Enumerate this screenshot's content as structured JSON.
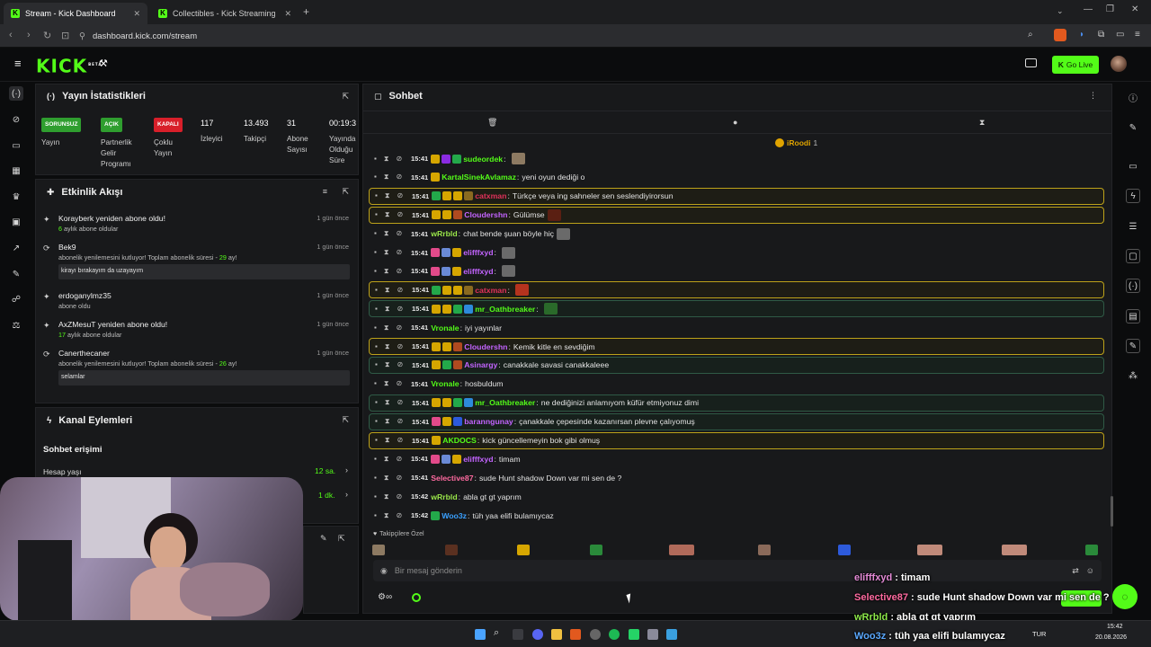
{
  "browser": {
    "tabs": [
      {
        "title": "Stream - Kick Dashboard",
        "active": true
      },
      {
        "title": "Collectibles - Kick Streaming",
        "active": false
      }
    ],
    "url": "dashboard.kick.com/stream"
  },
  "header": {
    "logo": "KICK",
    "logo_tag": "BETA",
    "go_live": "Go Live"
  },
  "stats_panel": {
    "title": "Yayın İstatistikleri",
    "items": [
      {
        "badge": "SORUNSUZ",
        "badge_color": "#2f9e2f",
        "label": "Yayın"
      },
      {
        "badge": "AÇIK",
        "badge_color": "#2f9e2f",
        "label": "Partnerlik Gelir Programı"
      },
      {
        "badge": "KAPALI",
        "badge_color": "#d81f2a",
        "label": "Çoklu Yayın"
      },
      {
        "value": "117",
        "label": "İzleyici"
      },
      {
        "value": "13.493",
        "label": "Takipçi"
      },
      {
        "value": "31",
        "label": "Abone Sayısı"
      },
      {
        "value": "00:19:3",
        "label": "Yayında Olduğu Süre"
      }
    ]
  },
  "activity_panel": {
    "title": "Etkinlik Akışı",
    "events": [
      {
        "name": "Korayberk yeniden abone oldu!",
        "sub_num": "6",
        "sub": " aylık abone oldular",
        "time": "1 gün önce",
        "msg": ""
      },
      {
        "name": "Bek9",
        "sub": "abonelik yenilemesini kutluyor! Toplam abonelik süresi - ",
        "sub_num2": "29",
        "sub_end": " ay!",
        "time": "1 gün önce",
        "msg": "kirayı bırakayım da uzayayım"
      },
      {
        "name": "erdoganylmz35",
        "sub": "abone oldu",
        "time": "1 gün önce",
        "msg": ""
      },
      {
        "name": "AxZMesuT yeniden abone oldu!",
        "sub_num": "17",
        "sub": " aylık abone oldular",
        "time": "1 gün önce",
        "msg": ""
      },
      {
        "name": "Canerthecaner",
        "sub": "abonelik yenilemesini kutluyor! Toplam abonelik süresi - ",
        "sub_num2": "26",
        "sub_end": " ay!",
        "time": "1 gün önce",
        "msg": "selamlar"
      }
    ]
  },
  "channel_panel": {
    "title": "Kanal Eylemleri",
    "section": "Sohbet erişimi",
    "rows": [
      {
        "label": "Hesap yaşı",
        "value": "12 sa."
      },
      {
        "label": "",
        "value": "1 dk."
      }
    ]
  },
  "chat": {
    "title": "Sohbet",
    "pinned_user": "iRoodi",
    "pinned_count": "1",
    "messages": [
      {
        "time": "15:41",
        "user": "sudeordek",
        "color": "#53fc18",
        "text": "",
        "hl": "",
        "badges": [
          "#d6a600",
          "#8a2be2",
          "#23a94a"
        ],
        "emote": "#8d7a62"
      },
      {
        "time": "15:41",
        "user": "KartalSinekAvlamaz",
        "color": "#53fc18",
        "text": "yeni oyun dediği o",
        "hl": "",
        "badges": [
          "#d6a600"
        ],
        "emote": ""
      },
      {
        "time": "15:41",
        "user": "catxman",
        "color": "#e0315a",
        "text": "Türkçe veya ing sahneler sen seslendiyirorsun",
        "hl": "gold",
        "badges": [
          "#23a94a",
          "#d6a600",
          "#d6a600",
          "#8a6a20"
        ],
        "emote": ""
      },
      {
        "time": "15:41",
        "user": "Cloudershn",
        "color": "#c364ff",
        "text": "Gülümse",
        "hl": "gold",
        "badges": [
          "#d6a600",
          "#d6a600",
          "#b04a20"
        ],
        "emote": "#5a1f12"
      },
      {
        "time": "15:41",
        "user": "wRrbld",
        "color": "#9be84a",
        "text": "chat bende şuan böyle hiç",
        "hl": "",
        "badges": [],
        "emote": "#6a6a6a"
      },
      {
        "time": "15:41",
        "user": "elifffxyd",
        "color": "#c364ff",
        "text": "",
        "hl": "",
        "badges": [
          "#e24a8a",
          "#6a8ad6",
          "#d6a600"
        ],
        "emote": "#6a6a6a"
      },
      {
        "time": "15:41",
        "user": "elifffxyd",
        "color": "#c364ff",
        "text": "",
        "hl": "",
        "badges": [
          "#e24a8a",
          "#6a8ad6",
          "#d6a600"
        ],
        "emote": "#6a6a6a"
      },
      {
        "time": "15:41",
        "user": "catxman",
        "color": "#e0315a",
        "text": "",
        "hl": "gold",
        "badges": [
          "#23a94a",
          "#d6a600",
          "#d6a600",
          "#8a6a20"
        ],
        "emote": "#b5331e"
      },
      {
        "time": "15:41",
        "user": "mr_Oathbreaker",
        "color": "#53fc18",
        "text": "",
        "hl": "green",
        "badges": [
          "#d6a600",
          "#d6a600",
          "#23a94a",
          "#2d8adb"
        ],
        "emote": "#2a6a2a"
      },
      {
        "time": "15:41",
        "user": "Vronale",
        "color": "#53fc18",
        "text": "iyi yayınlar",
        "hl": "",
        "badges": [],
        "emote": ""
      },
      {
        "time": "15:41",
        "user": "Cloudershn",
        "color": "#c364ff",
        "text": "Kemik kitle en sevdiğim",
        "hl": "gold",
        "badges": [
          "#d6a600",
          "#d6a600",
          "#b04a20"
        ],
        "emote": ""
      },
      {
        "time": "15:41",
        "user": "Asinargy",
        "color": "#c364ff",
        "text": "canakkale savasi canakkaleee",
        "hl": "green",
        "badges": [
          "#d6a600",
          "#23a94a",
          "#b04a20"
        ],
        "emote": ""
      },
      {
        "time": "15:41",
        "user": "Vronale",
        "color": "#53fc18",
        "text": "hosbuldum",
        "hl": "",
        "badges": [],
        "emote": ""
      },
      {
        "time": "15:41",
        "user": "mr_Oathbreaker",
        "color": "#53fc18",
        "text": "ne dediğinizi anlamıyom küfür etmiyonuz dimi",
        "hl": "green",
        "badges": [
          "#d6a600",
          "#d6a600",
          "#23a94a",
          "#2d8adb"
        ],
        "emote": ""
      },
      {
        "time": "15:41",
        "user": "baranngunay",
        "color": "#c364ff",
        "text": "çanakkale çepesinde kazanırsan plevne çalıyomuş",
        "hl": "green",
        "badges": [
          "#e24a8a",
          "#d6a600",
          "#2d5adb"
        ],
        "emote": ""
      },
      {
        "time": "15:41",
        "user": "AKDOCS",
        "color": "#53fc18",
        "text": "kick güncellemeyin bok gibi olmuş",
        "hl": "gold",
        "badges": [
          "#d6a600"
        ],
        "emote": ""
      },
      {
        "time": "15:41",
        "user": "elifffxyd",
        "color": "#c364ff",
        "text": "timam",
        "hl": "",
        "badges": [
          "#e24a8a",
          "#6a8ad6",
          "#d6a600"
        ],
        "emote": ""
      },
      {
        "time": "15:41",
        "user": "Selective87",
        "color": "#ff6aa0",
        "text": "sude Hunt shadow Down var mi sen de ?",
        "hl": "",
        "badges": [],
        "emote": ""
      },
      {
        "time": "15:42",
        "user": "wRrbld",
        "color": "#9be84a",
        "text": "abla gt gt yaprım",
        "hl": "",
        "badges": [],
        "emote": ""
      },
      {
        "time": "15:42",
        "user": "Woo3z",
        "color": "#3aa0ff",
        "text": "tüh yaa elifi bulamıycaz",
        "hl": "",
        "badges": [
          "#23a94a"
        ],
        "emote": ""
      }
    ],
    "emote_bar_label": "Takipçilere Özel",
    "input_placeholder": "Bir mesaj gönderin"
  },
  "overlay_chat": [
    {
      "user": "elifffxyd",
      "color": "#e48ad6",
      "text": " : timam"
    },
    {
      "user": "Selective87",
      "color": "#ff6aa0",
      "text": " : sude Hunt shadow Down var mi sen de ?"
    },
    {
      "user": "wRrbld",
      "color": "#8de84a",
      "text": " : abla gt gt yaprım"
    },
    {
      "user": "Woo3z",
      "color": "#5aa8ff",
      "text": " : tüh yaa elifi bulamıycaz"
    }
  ],
  "taskbar": {
    "lang": "TUR",
    "time": "15:42",
    "date": "20.08.2026"
  },
  "colors": {
    "accent": "#53fc18",
    "gold": "#bda21a"
  }
}
